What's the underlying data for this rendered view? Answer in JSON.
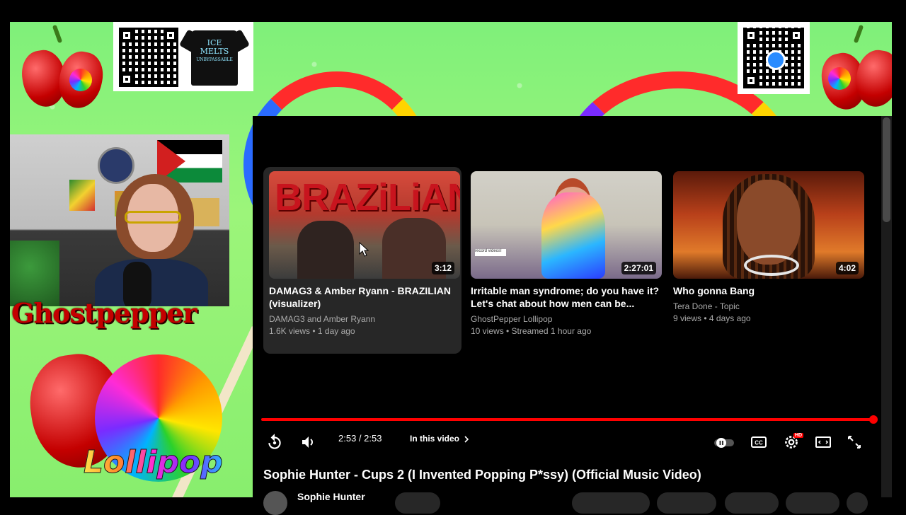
{
  "overlay": {
    "brand_top": "Ghostpepper",
    "brand_bottom": "Lollipop",
    "shirt_text_line1": "ICE",
    "shirt_text_line2": "MELTS",
    "shirt_text_line3": "UNBYPASSABLE"
  },
  "player": {
    "cards": [
      {
        "title": "DAMAG3 & Amber Ryann - BRAZILIAN (visualizer)",
        "channel": "DAMAG3 and Amber Ryann",
        "meta": "1.6K views • 1 day ago",
        "duration": "3:12",
        "thumb_word": "BRAZiLiAN"
      },
      {
        "title": "Irritable man syndrome; do you have it? Let's chat about how men can be...",
        "channel": "GhostPepper Lollipop",
        "meta": "10 views • Streamed 1 hour ago",
        "duration": "2:27:01",
        "thumb_note": "record videos!"
      },
      {
        "title": "Who gonna Bang",
        "channel": "Tera Done - Topic",
        "meta": "9 views • 4 days ago",
        "duration": "4:02"
      }
    ],
    "progress_fraction": 1.0,
    "time": "2:53 / 2:53",
    "in_this_video": "In this video",
    "video_title": "Sophie Hunter - Cups 2 (I Invented Popping P*ssy) (Official Music Video)",
    "channel_name": "Sophie Hunter",
    "hd_badge": "HD",
    "icons": [
      "replay-icon",
      "volume-icon",
      "chevron-right-icon",
      "autoplay-toggle-icon",
      "captions-icon",
      "settings-icon",
      "theater-icon",
      "fullscreen-icon"
    ],
    "accent": "#ff0000"
  }
}
